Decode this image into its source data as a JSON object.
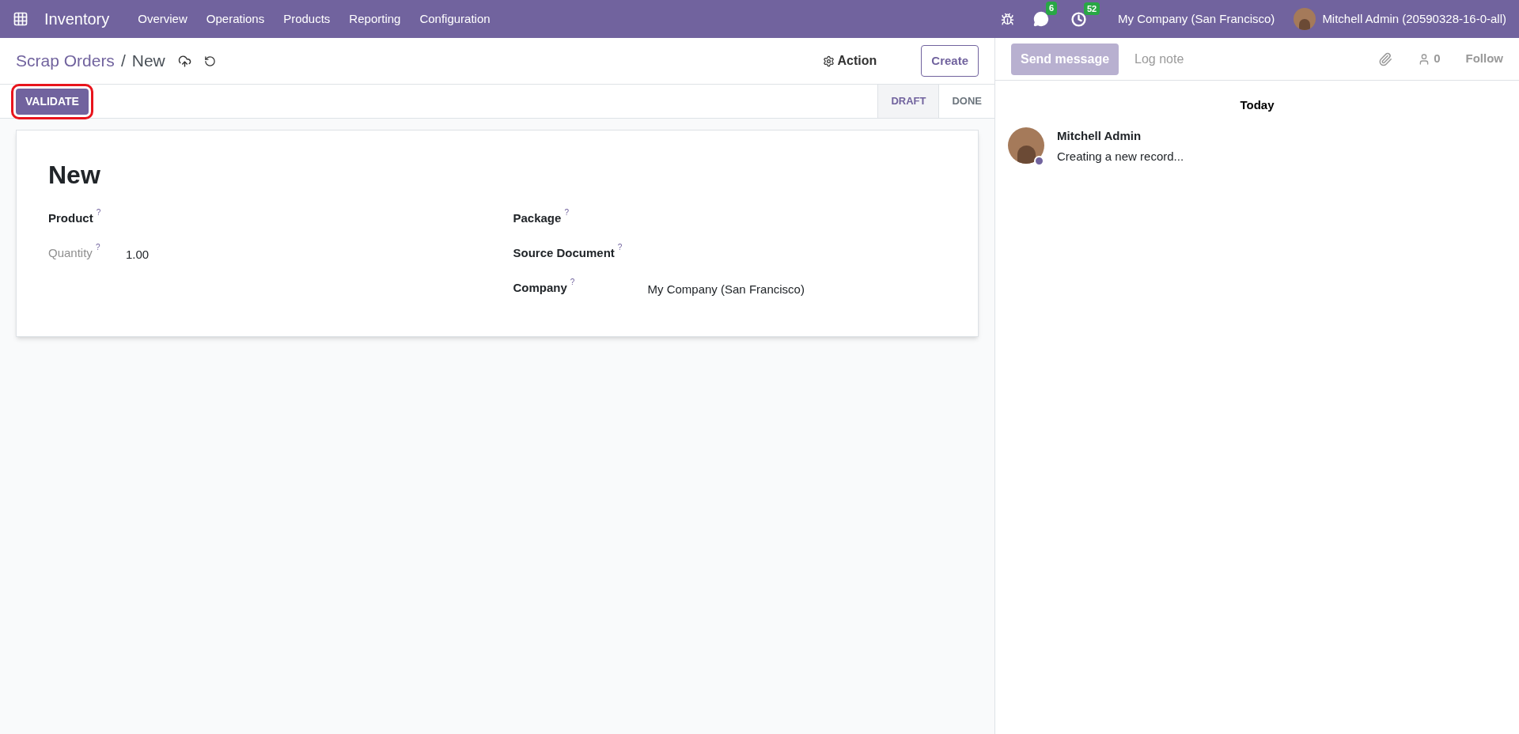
{
  "navbar": {
    "app_name": "Inventory",
    "menu": [
      "Overview",
      "Operations",
      "Products",
      "Reporting",
      "Configuration"
    ],
    "messages_count": "6",
    "activities_count": "52",
    "company": "My Company (San Francisco)",
    "user": "Mitchell Admin (20590328-16-0-all)"
  },
  "breadcrumb": {
    "parent": "Scrap Orders",
    "separator": "/",
    "current": "New"
  },
  "actions": {
    "action_label": "Action",
    "create_label": "Create"
  },
  "statusbar": {
    "validate": {
      "label": "VALIDATE",
      "highlighted": true
    },
    "stages": [
      {
        "label": "DRAFT",
        "selected": true
      },
      {
        "label": "DONE",
        "selected": false
      }
    ]
  },
  "form": {
    "title": "New",
    "left_fields": [
      {
        "label": "Product",
        "help": "?",
        "muted": false
      },
      {
        "label": "Quantity",
        "help": "?",
        "muted": true,
        "value": "1.00"
      }
    ],
    "right_fields": [
      {
        "label": "Package",
        "help": "?",
        "muted": false
      },
      {
        "label": "Source Document",
        "help": "?",
        "muted": false
      },
      {
        "label": "Company",
        "help": "?",
        "muted": false,
        "value": "My Company (San Francisco)"
      }
    ]
  },
  "chatter": {
    "send_message": "Send message",
    "log_note": "Log note",
    "followers_count": "0",
    "follow": "Follow",
    "date_separator": "Today",
    "messages": [
      {
        "author": "Mitchell Admin",
        "body": "Creating a new record..."
      }
    ]
  }
}
